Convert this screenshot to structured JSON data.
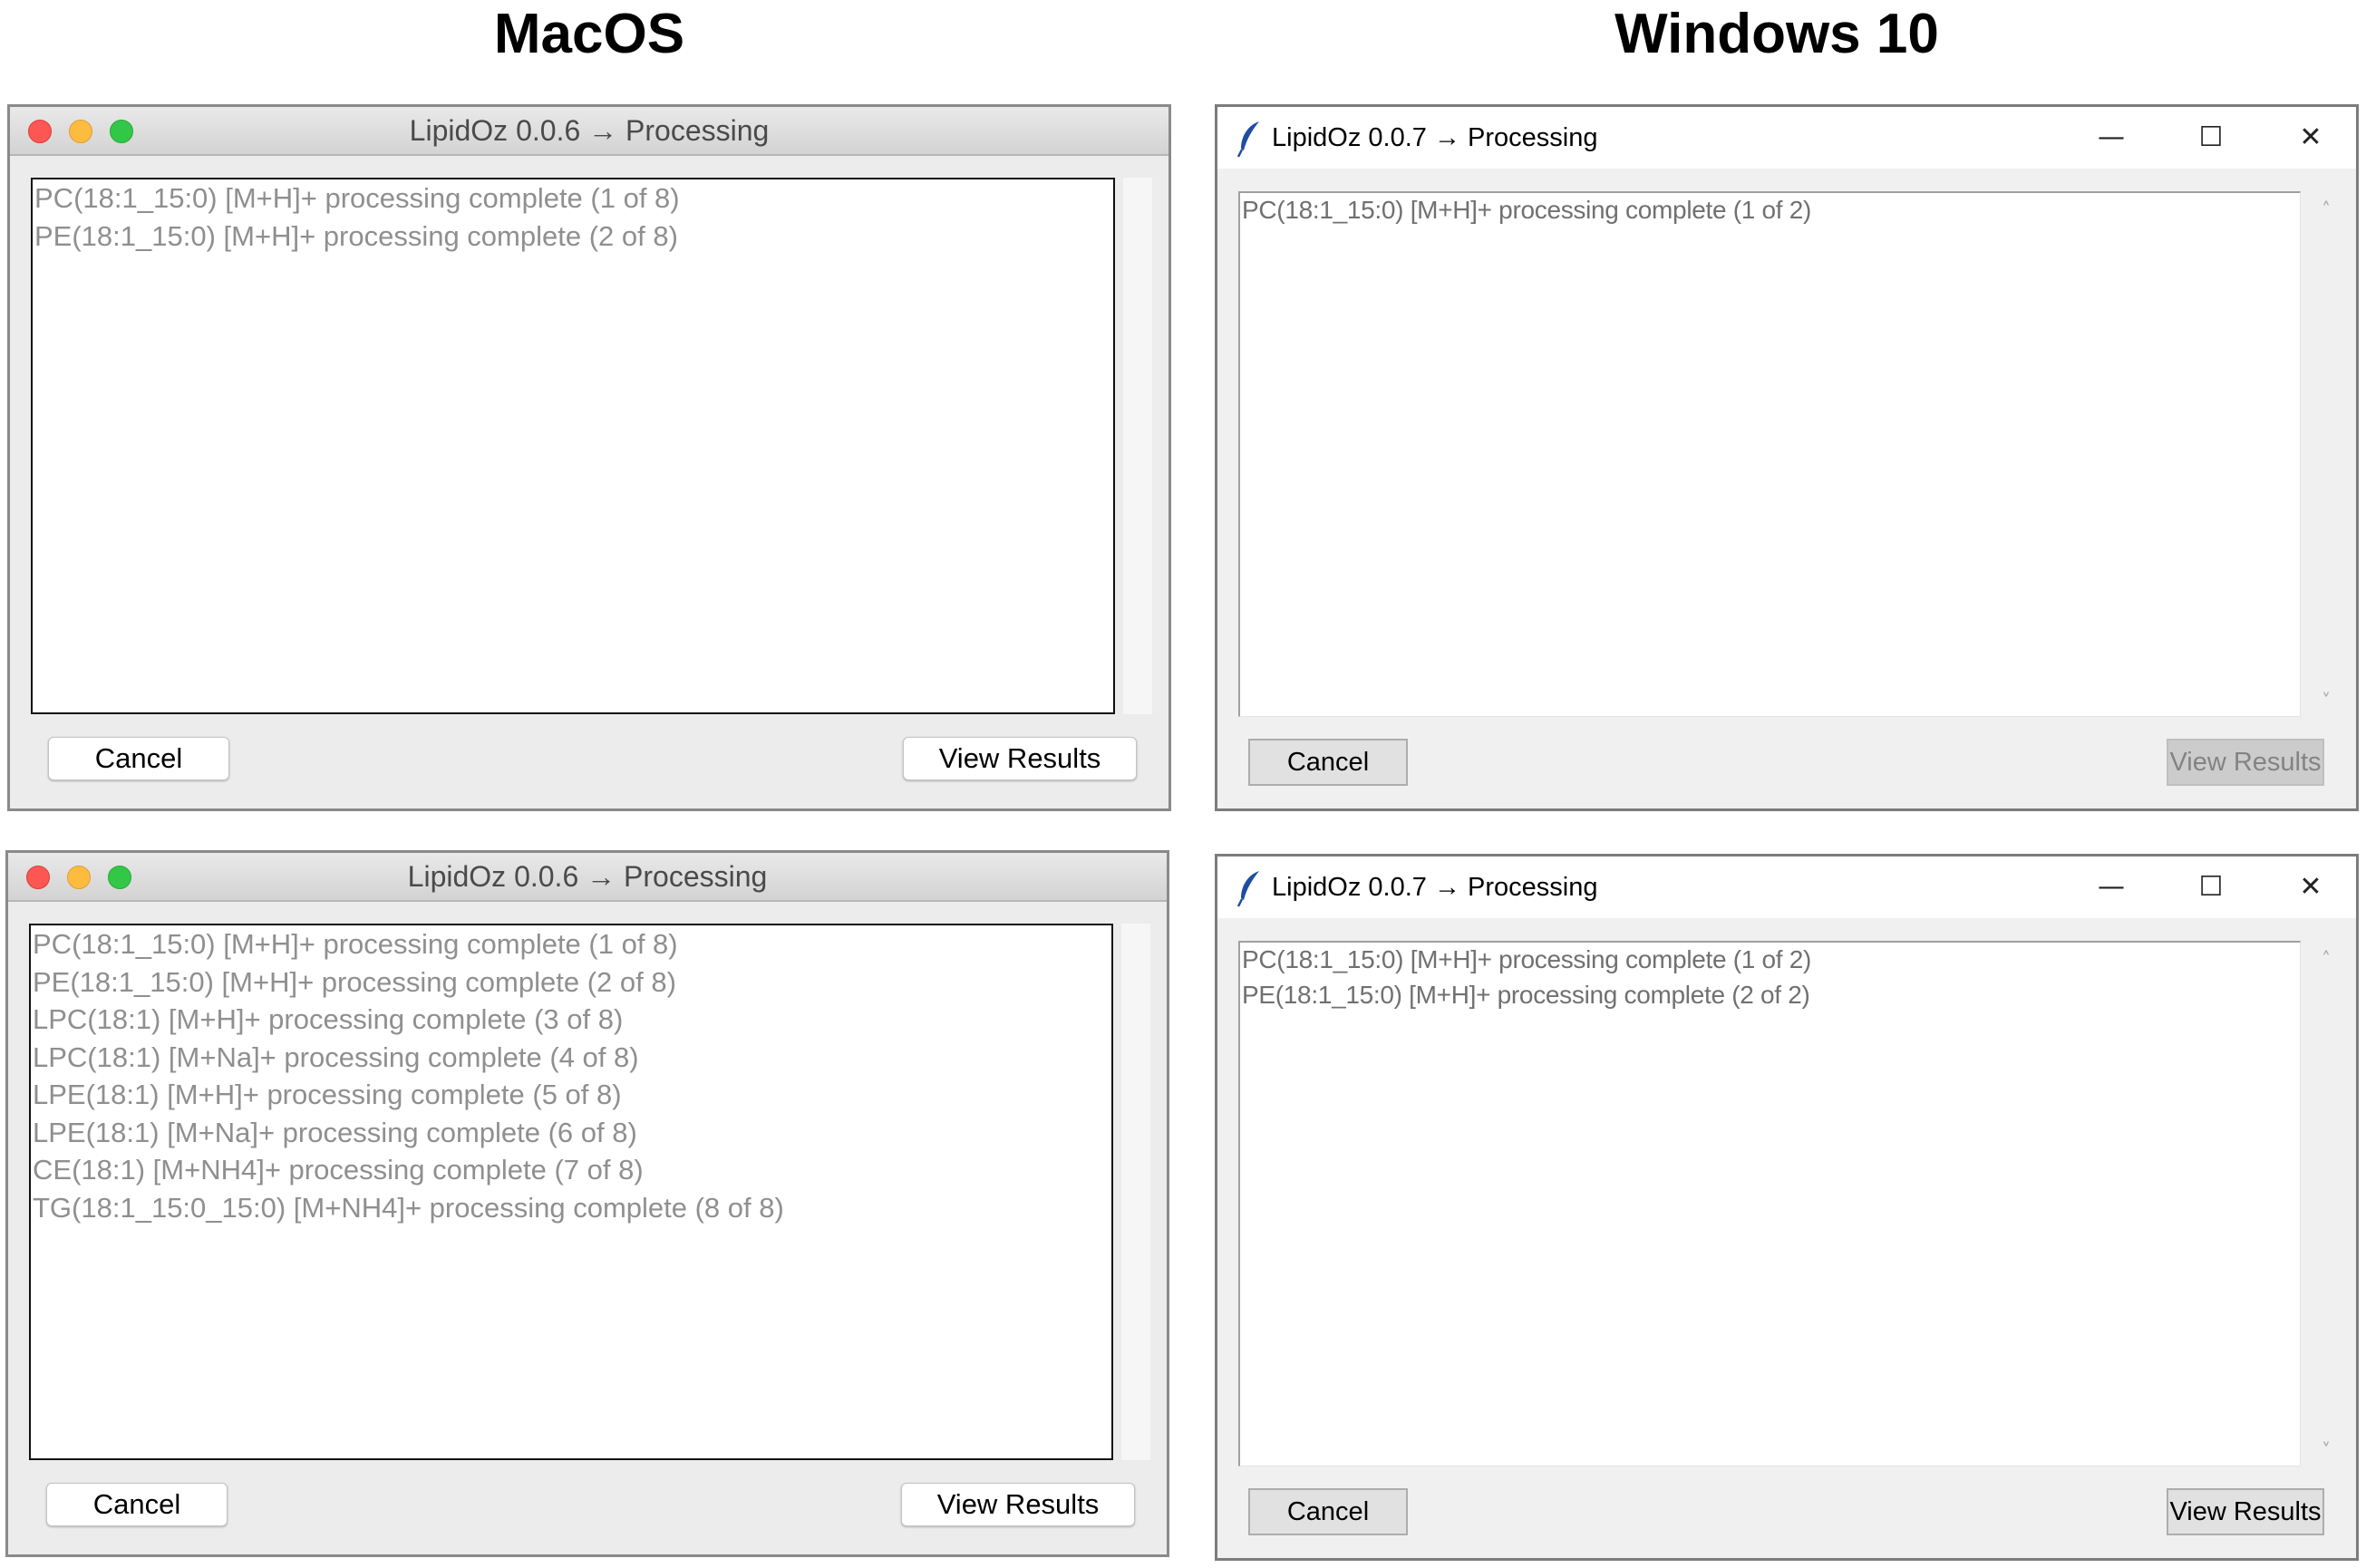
{
  "headings": {
    "macos": "MacOS",
    "windows": "Windows 10"
  },
  "mac_top": {
    "title": "LipidOz 0.0.6 → Processing",
    "lines": [
      "PC(18:1_15:0) [M+H]+ processing complete (1 of 8)",
      "PE(18:1_15:0) [M+H]+ processing complete (2 of 8)"
    ],
    "cancel_label": "Cancel",
    "view_label": "View Results"
  },
  "mac_bottom": {
    "title": "LipidOz 0.0.6 → Processing",
    "lines": [
      "PC(18:1_15:0) [M+H]+ processing complete (1 of 8)",
      "PE(18:1_15:0) [M+H]+ processing complete (2 of 8)",
      "LPC(18:1) [M+H]+ processing complete (3 of 8)",
      "LPC(18:1) [M+Na]+ processing complete (4 of 8)",
      "LPE(18:1) [M+H]+ processing complete (5 of 8)",
      "LPE(18:1) [M+Na]+ processing complete (6 of 8)",
      "CE(18:1) [M+NH4]+ processing complete (7 of 8)",
      "TG(18:1_15:0_15:0) [M+NH4]+ processing complete (8 of 8)"
    ],
    "cancel_label": "Cancel",
    "view_label": "View Results"
  },
  "win_top": {
    "title": "LipidOz 0.0.7 → Processing",
    "lines": [
      "PC(18:1_15:0) [M+H]+ processing complete (1 of 2)"
    ],
    "cancel_label": "Cancel",
    "view_label": "View Results",
    "view_enabled": false
  },
  "win_bottom": {
    "title": "LipidOz 0.0.7 → Processing",
    "lines": [
      "PC(18:1_15:0) [M+H]+ processing complete (1 of 2)",
      "PE(18:1_15:0) [M+H]+ processing complete (2 of 2)"
    ],
    "cancel_label": "Cancel",
    "view_label": "View Results",
    "view_enabled": true
  },
  "window_controls": {
    "minimize": "—",
    "maximize": "☐",
    "close": "✕"
  },
  "icons": {
    "mac_close": "red-circle",
    "mac_minimize": "yellow-circle",
    "mac_zoom": "green-circle",
    "win_app": "feather-icon",
    "scroll_up": "˄",
    "scroll_down": "˅"
  },
  "colors": {
    "mac_close": "#fc5753",
    "mac_minimize": "#fdbc40",
    "mac_zoom": "#33c748",
    "feather": "#1f4e9e"
  }
}
